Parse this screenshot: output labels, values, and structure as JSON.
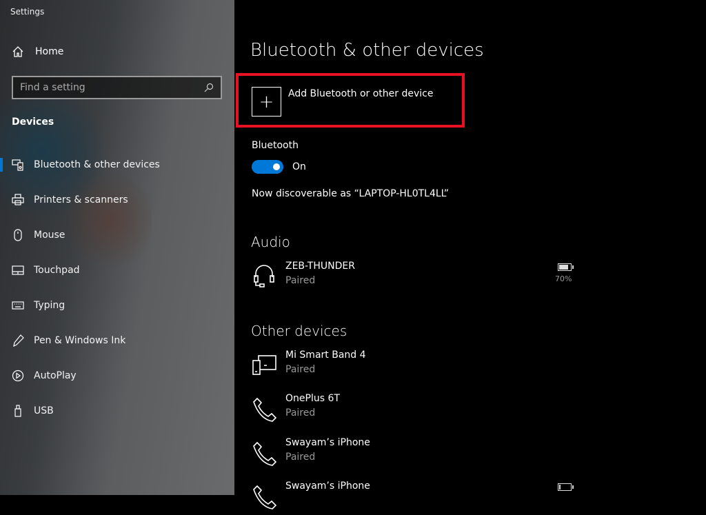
{
  "app_title": "Settings",
  "sidebar": {
    "home": "Home",
    "search_placeholder": "Find a setting",
    "section": "Devices",
    "items": [
      {
        "label": "Bluetooth & other devices",
        "icon": "bluetooth-devices-icon",
        "selected": true
      },
      {
        "label": "Printers & scanners",
        "icon": "printer-icon"
      },
      {
        "label": "Mouse",
        "icon": "mouse-icon"
      },
      {
        "label": "Touchpad",
        "icon": "touchpad-icon"
      },
      {
        "label": "Typing",
        "icon": "keyboard-icon"
      },
      {
        "label": "Pen & Windows Ink",
        "icon": "pen-icon"
      },
      {
        "label": "AutoPlay",
        "icon": "autoplay-icon"
      },
      {
        "label": "USB",
        "icon": "usb-icon"
      }
    ]
  },
  "main": {
    "title": "Bluetooth & other devices",
    "add_device": "Add Bluetooth or other device",
    "bluetooth_label": "Bluetooth",
    "bluetooth_state": "On",
    "bluetooth_on": true,
    "discoverable": "Now discoverable as “LAPTOP-HL0TL4LL”",
    "audio_heading": "Audio",
    "audio_devices": [
      {
        "name": "ZEB-THUNDER",
        "status": "Paired",
        "battery": "70%",
        "battery_level": 0.7
      }
    ],
    "other_heading": "Other devices",
    "other_devices": [
      {
        "name": "Mi Smart Band 4",
        "status": "Paired",
        "icon": "devices-icon"
      },
      {
        "name": "OnePlus 6T",
        "status": "Paired",
        "icon": "phone-icon"
      },
      {
        "name": "Swayam’s iPhone",
        "status": "Paired",
        "icon": "phone-icon"
      },
      {
        "name": "Swayam’s iPhone",
        "icon": "phone-icon",
        "battery_level": 0.1
      }
    ]
  },
  "colors": {
    "accent": "#0078d7",
    "highlight": "#e81123"
  }
}
